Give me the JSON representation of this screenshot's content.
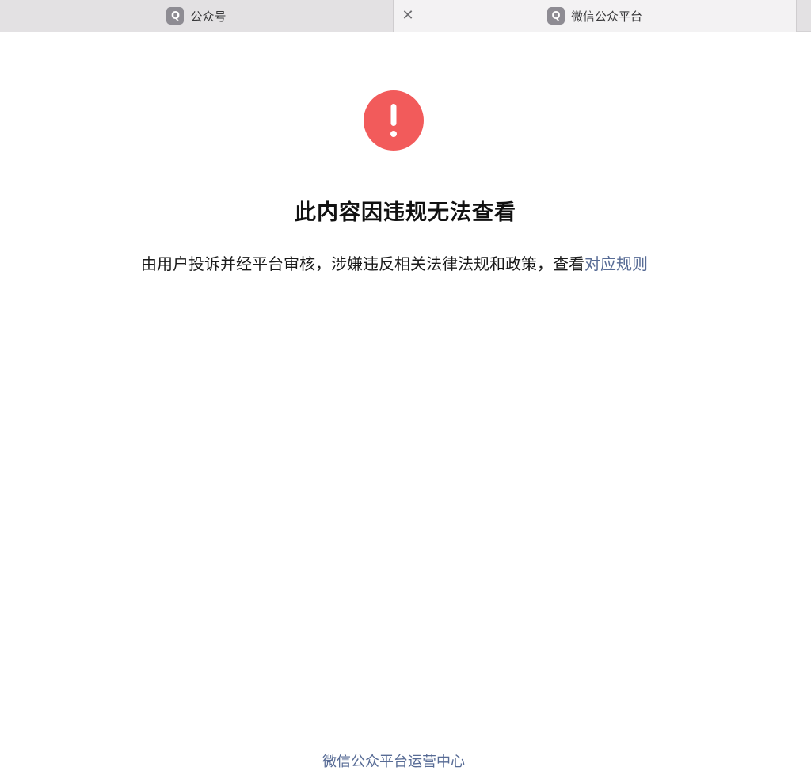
{
  "tabs": [
    {
      "label": "公众号",
      "icon_letter": "Q",
      "icon": "q-app-icon"
    },
    {
      "label": "微信公众平台",
      "icon_letter": "Q",
      "icon": "q-app-icon",
      "close_glyph": "✕"
    }
  ],
  "notice": {
    "icon": "exclamation-circle-icon",
    "icon_color": "#f25b5b",
    "title": "此内容因违规无法查看",
    "description": "由用户投诉并经平台审核，涉嫌违反相关法律法规和政策，查看",
    "rules_link": "对应规则",
    "link_color": "#576b95"
  },
  "footer": {
    "link": "微信公众平台运营中心"
  }
}
